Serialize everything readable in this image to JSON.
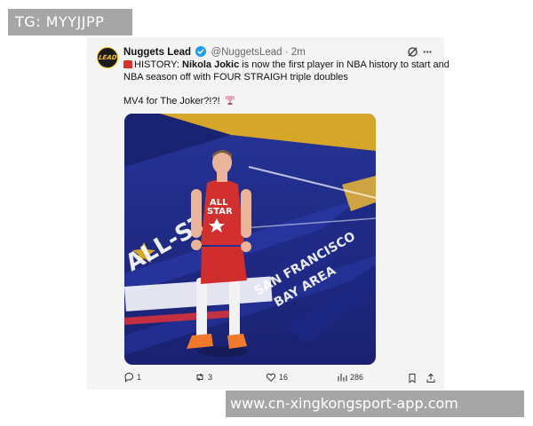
{
  "top_badge": "TG: MYYJJPP",
  "watermark": "www.cn-xingkongsport-app.com",
  "tweet": {
    "avatar_text": "LEAD",
    "display_name": "Nuggets Lead",
    "handle": "@NuggetsLead",
    "separator": "·",
    "time": "2m",
    "line1_prefix": "HISTORY: ",
    "line1_bold": "Nikola Jokic",
    "line1_rest": " is now the first player in NBA history to start and",
    "line2": "NBA season off with FOUR STRAIGH triple doubles",
    "line3": "MV4 for The Joker?!?!",
    "photo_texts": {
      "jersey_top": "ALL",
      "jersey_bottom": "STAR",
      "court_upper": "ALL-STAR",
      "court_lower": "SAN FRANCISCO",
      "court_lower2": "BAY AREA"
    }
  },
  "actions": {
    "replies": "1",
    "reposts": "3",
    "likes": "16",
    "views": "286"
  },
  "colors": {
    "court_blue": "#1f2b8c",
    "court_gold": "#d6a62b",
    "jersey_red": "#d2302e",
    "avatar_gold": "#f0c419",
    "verified_blue": "#1d9bf0"
  }
}
